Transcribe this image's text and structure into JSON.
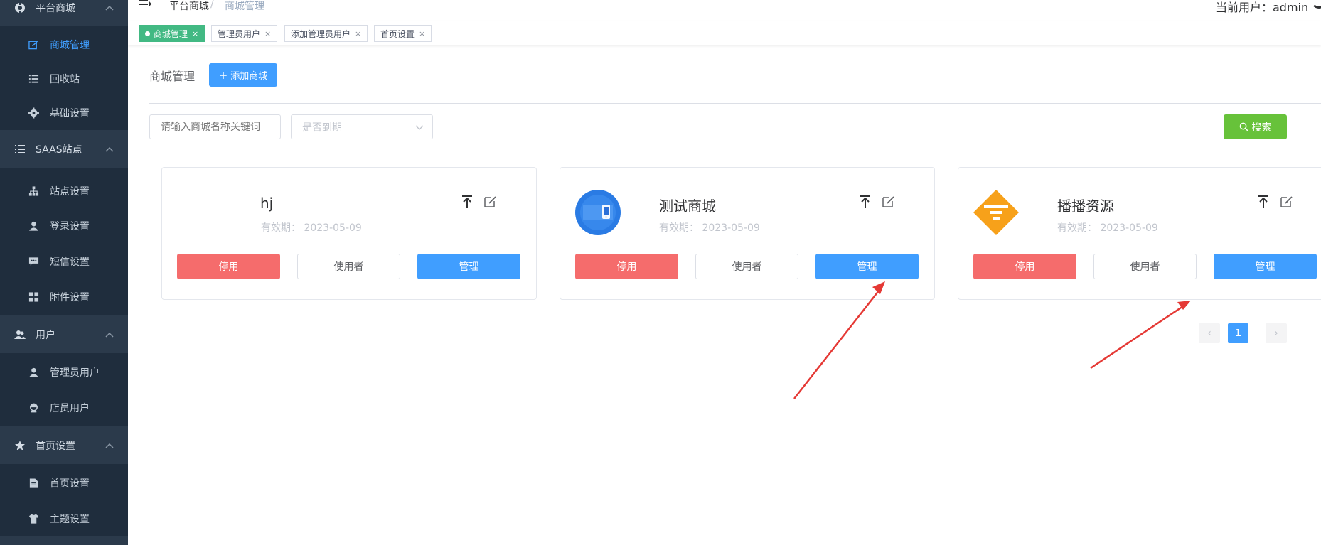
{
  "sidebar": {
    "groups": [
      {
        "label": "平台商城",
        "icon": "store-icon"
      },
      {
        "label": "SAAS站点",
        "icon": "list-icon"
      },
      {
        "label": "用户",
        "icon": "users-icon"
      },
      {
        "label": "首页设置",
        "icon": "star-icon"
      }
    ],
    "items": [
      {
        "label": "商城管理",
        "icon": "edit-icon",
        "active": true
      },
      {
        "label": "回收站",
        "icon": "list-icon"
      },
      {
        "label": "基础设置",
        "icon": "gear-icon"
      },
      {
        "label": "站点设置",
        "icon": "sitemap-icon"
      },
      {
        "label": "登录设置",
        "icon": "user-icon"
      },
      {
        "label": "短信设置",
        "icon": "message-icon"
      },
      {
        "label": "附件设置",
        "icon": "grid-icon"
      },
      {
        "label": "管理员用户",
        "icon": "user-icon"
      },
      {
        "label": "店员用户",
        "icon": "clerk-icon"
      },
      {
        "label": "首页设置",
        "icon": "document-icon"
      },
      {
        "label": "主题设置",
        "icon": "shirt-icon"
      }
    ]
  },
  "header": {
    "breadcrumb_root": "平台商城",
    "breadcrumb_sep": "/",
    "breadcrumb_current": "商城管理",
    "current_user_label": "当前用户：admin"
  },
  "tags": [
    {
      "label": "商城管理",
      "active": true
    },
    {
      "label": "管理员用户"
    },
    {
      "label": "添加管理员用户"
    },
    {
      "label": "首页设置"
    }
  ],
  "tag_close": "×",
  "main": {
    "title": "商城管理",
    "add_button": "添加商城",
    "search_placeholder": "请输入商城名称关键词",
    "expire_select_placeholder": "是否到期",
    "search_button": "搜索"
  },
  "cards": [
    {
      "name": "hj",
      "validity_label": "有效期：",
      "validity_date": "2023-05-09",
      "logo": "none"
    },
    {
      "name": "测试商城",
      "validity_label": "有效期：",
      "validity_date": "2023-05-09",
      "logo": "blue-app-logo"
    },
    {
      "name": "播播资源",
      "validity_label": "有效期：",
      "validity_date": "2023-05-09",
      "logo": "orange-diamond-logo"
    }
  ],
  "card_buttons": {
    "disable": "停用",
    "users": "使用者",
    "manage": "管理"
  },
  "pagination": {
    "prev": "‹",
    "current": "1",
    "next": "›"
  },
  "colors": {
    "sidebar_bg": "#1f2d3d",
    "sidebar_group_bg": "#2b3a4b",
    "primary": "#409eff",
    "success": "#67c23a",
    "danger": "#f56c6c",
    "tag_active": "#42b983",
    "annotation_arrow": "#e53935"
  }
}
